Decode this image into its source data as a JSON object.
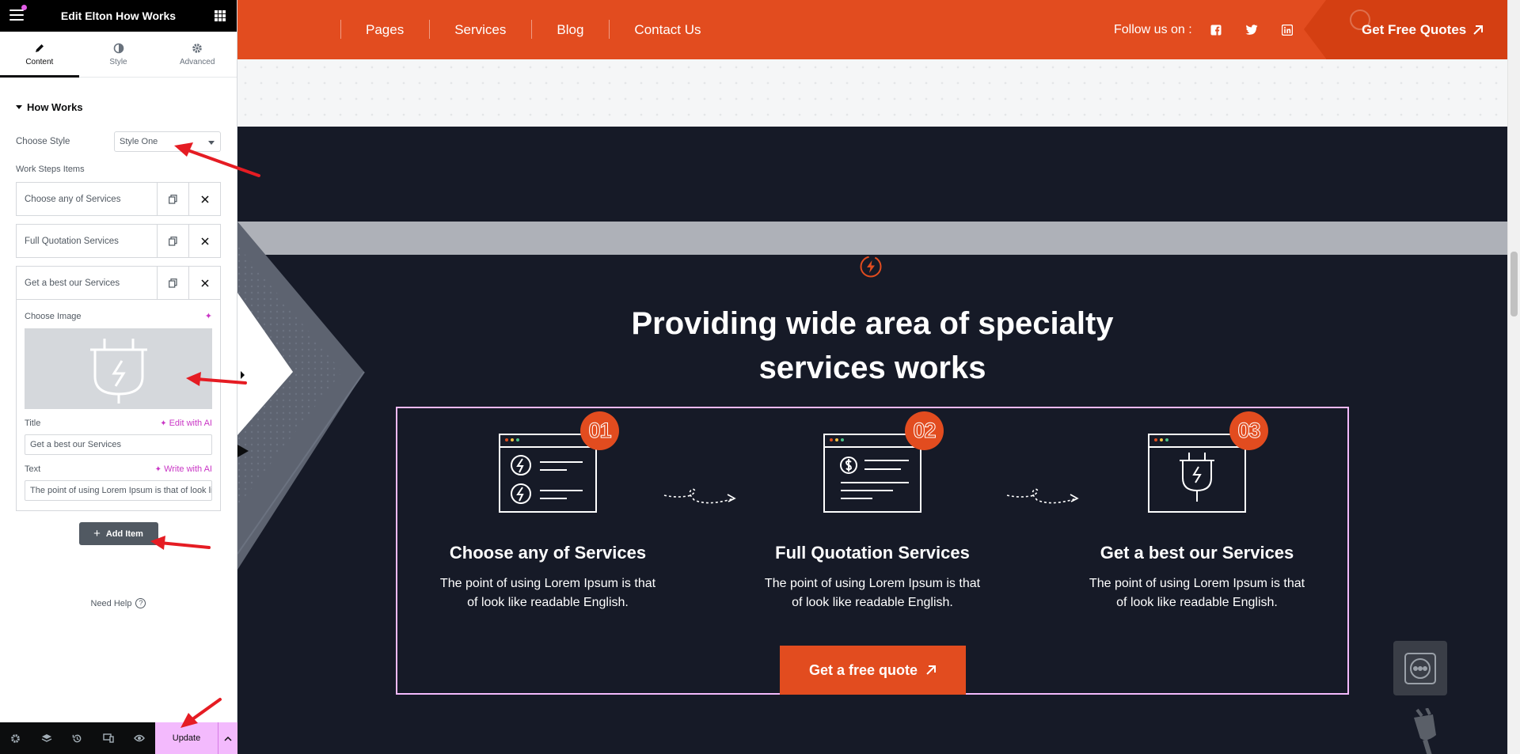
{
  "editor": {
    "title": "Edit Elton How Works",
    "tabs": [
      {
        "label": "Content",
        "icon": "pencil-icon"
      },
      {
        "label": "Style",
        "icon": "half-circle-icon"
      },
      {
        "label": "Advanced",
        "icon": "gear-icon"
      }
    ],
    "section": "How Works",
    "choose_style_label": "Choose Style",
    "choose_style_value": "Style One",
    "steps_label": "Work Steps Items",
    "items": [
      {
        "name": "Choose any of Services"
      },
      {
        "name": "Full Quotation Services"
      },
      {
        "name": "Get a best our Services"
      }
    ],
    "open_item": {
      "image_label": "Choose Image",
      "title_label": "Title",
      "edit_ai": "Edit with AI",
      "title_value": "Get a best our Services",
      "text_label": "Text",
      "write_ai": "Write with AI",
      "text_value": "The point of using Lorem Ipsum is that of look like readable English."
    },
    "add_item": "Add Item",
    "need_help": "Need Help",
    "update": "Update",
    "accent": "#f3bafd"
  },
  "site": {
    "nav": [
      "Pages",
      "Services",
      "Blog",
      "Contact Us"
    ],
    "follow_label": "Follow us on :",
    "socials": [
      "facebook-icon",
      "twitter-icon",
      "linkedin-icon"
    ],
    "quote_button": "Get Free Quotes",
    "heading_line1": "Providing wide area of specialty",
    "heading_line2": "services works",
    "steps": [
      {
        "num": "01",
        "title": "Choose any of Services",
        "text": "The point of using Lorem Ipsum is that of look like readable English.",
        "icon": "bolt-window-icon"
      },
      {
        "num": "02",
        "title": "Full Quotation Services",
        "text": "The point of using Lorem Ipsum is that of look like readable English.",
        "icon": "dollar-window-icon"
      },
      {
        "num": "03",
        "title": "Get a best our Services",
        "text": "The point of using Lorem Ipsum is that of look like readable English.",
        "icon": "plug-window-icon"
      }
    ],
    "cta": "Get a free quote",
    "brand_color": "#e24c1f",
    "dark_bg": "#161a27"
  }
}
